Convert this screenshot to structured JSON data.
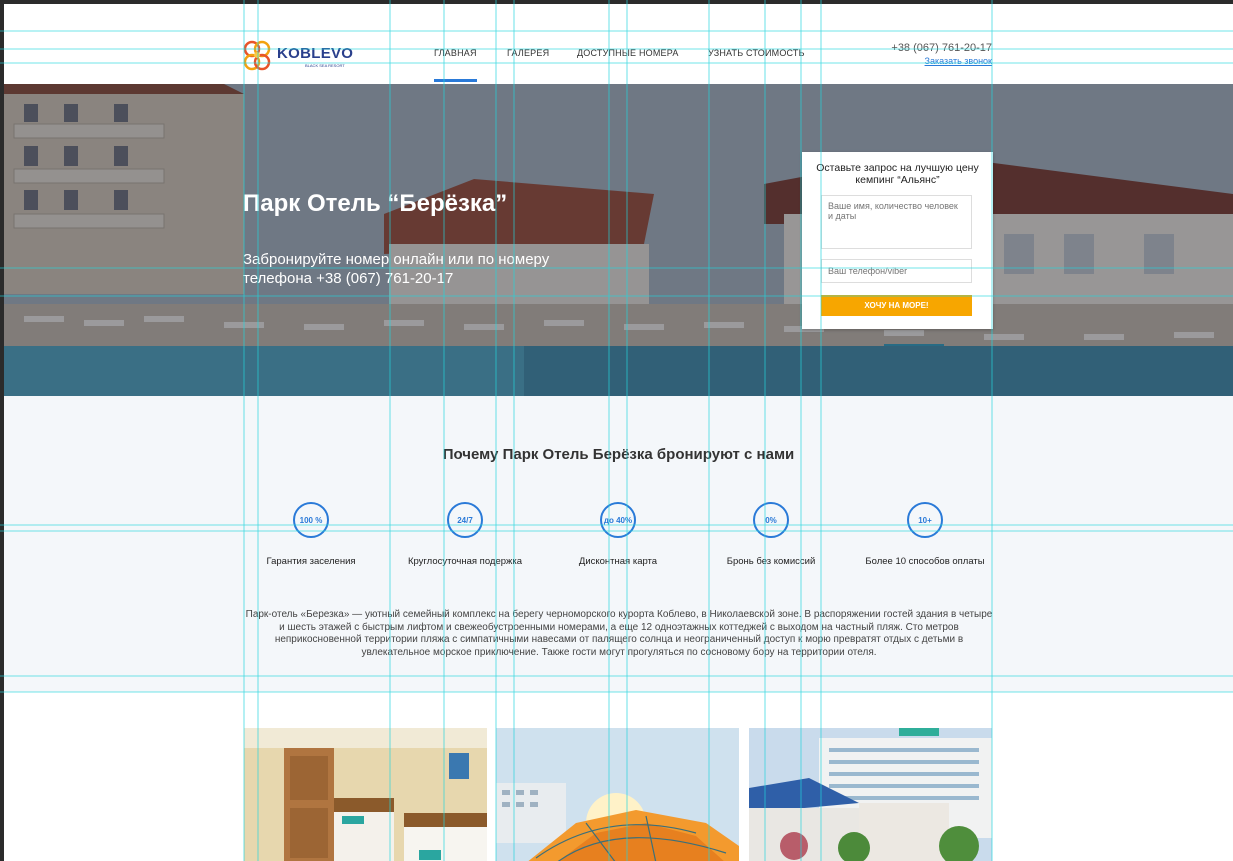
{
  "header": {
    "logo": {
      "name": "KOBLEVO",
      "tagline": "BLACK SEA RESORT"
    },
    "nav": [
      {
        "label": "ГЛАВНАЯ",
        "active": true
      },
      {
        "label": "ГАЛЕРЕЯ",
        "active": false
      },
      {
        "label": "ДОСТУПНЫЕ НОМЕРА",
        "active": false
      },
      {
        "label": "УЗНАТЬ СТОИМОСТЬ",
        "active": false
      }
    ],
    "phone": "+38 (067) 761-20-17",
    "callback_link": "Заказать звонок"
  },
  "hero": {
    "title": "Парк Отель “Берёзка”",
    "subtitle": "Забронируйте номер онлайн или по номеру телефона +38 (067) 761-20-17"
  },
  "form": {
    "title": "Оставьте запрос на лучшую цену кемпинг “Альянс”",
    "textarea_placeholder": "Ваше имя, количество человек и даты",
    "phone_placeholder": "Ваш телефон/viber",
    "button_label": "ХОЧУ НА МОРЕ!"
  },
  "why": {
    "title": "Почему Парк Отель Берёзка бронируют с нами",
    "features": [
      {
        "badge": "100 %",
        "label": "Гарантия заселения"
      },
      {
        "badge": "24/7",
        "label": "Круглосуточная подержка"
      },
      {
        "badge": "до 40%",
        "label": "Дисконтная карта"
      },
      {
        "badge": "0%",
        "label": "Бронь без комиссий"
      },
      {
        "badge": "10+",
        "label": "Более 10 способов оплаты"
      }
    ],
    "description": "Парк-отель «Березка» — уютный семейный комплекс на берегу черноморского курорта Коблево, в Николаевской зоне.   В распоряжении гостей здания в четыре и шесть этажей с быстрым лифтом и свежеобустроенными номерами, а еще 12 одноэтажных коттеджей с выходом на частный пляж. Сто метров неприкосновенной территории пляжа с симпатичными навесами от палящего солнца и неограниченный доступ к морю превратят отдых с детьми в увлекательное морское приключение. Также гости могут прогуляться по сосновому бору на территории отеля."
  },
  "colors": {
    "accent": "#2a7ad8",
    "button": "#f7a600",
    "brand": "#2a3f8c",
    "guide": "#23d5dd"
  }
}
